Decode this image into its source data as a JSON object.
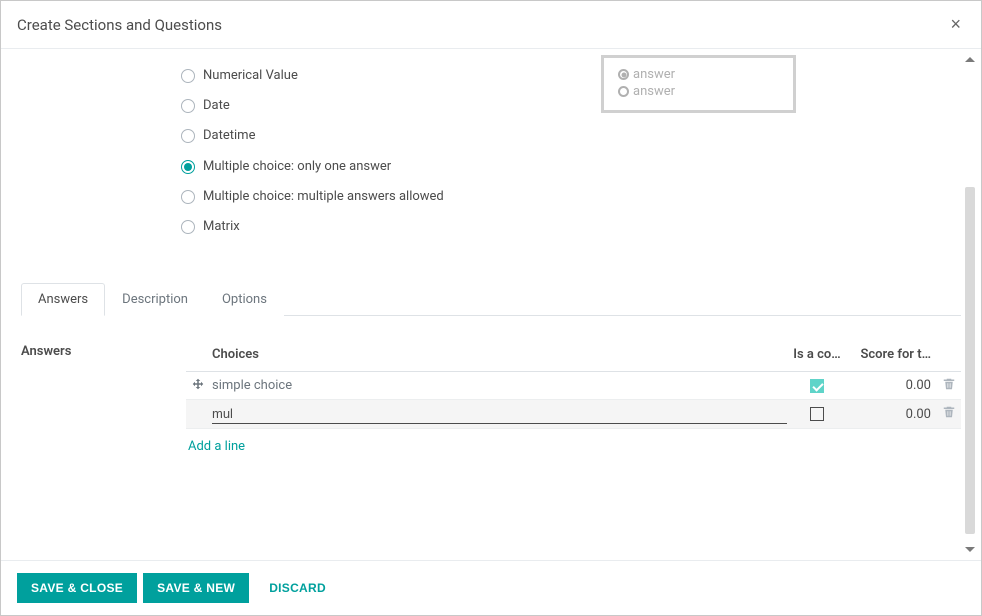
{
  "modal": {
    "title": "Create Sections and Questions"
  },
  "question_types": {
    "numerical": "Numerical Value",
    "date": "Date",
    "datetime": "Datetime",
    "single": "Multiple choice: only one answer",
    "multiple": "Multiple choice: multiple answers allowed",
    "matrix": "Matrix"
  },
  "preview": {
    "line1": "answer",
    "line2": "answer"
  },
  "tabs": {
    "answers": "Answers",
    "description": "Description",
    "options": "Options"
  },
  "answers": {
    "section_label": "Answers",
    "headers": {
      "choices": "Choices",
      "is_correct": "Is a co…",
      "score": "Score for t…"
    },
    "rows": [
      {
        "choice": "simple choice",
        "is_correct": true,
        "score": "0.00"
      },
      {
        "choice": "mul",
        "is_correct": false,
        "score": "0.00",
        "editing": true
      }
    ],
    "add_line": "Add a line"
  },
  "footer": {
    "save_close": "SAVE & CLOSE",
    "save_new": "SAVE & NEW",
    "discard": "DISCARD"
  }
}
